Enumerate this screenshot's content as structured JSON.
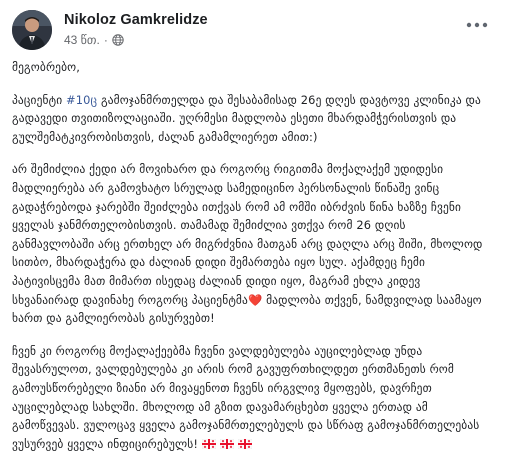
{
  "post": {
    "author": "Nikoloz Gamkrelidze",
    "time": "43 წთ.",
    "separator": "·",
    "privacy_icon": "globe-icon",
    "more_icon": "ellipsis-icon"
  },
  "paragraphs": {
    "p0": "მეგობრებო,",
    "p1_before": "პაციენტი ",
    "p1_hashtag": "#10ც",
    "p1_after": " გამოჯანმრთელდა და შესაბამისად 26ე დღეს დავტოვე კლინიკა და გადავედი თვითიზოლაციაში. უღრმესი მადლობა ესეთი მხარდამჭერისთვის და გულშემატკივრობისთვის, ძალან გამამლიერეთ ამით:)",
    "p2_before": "არ შემიძლია ქედი არ მოვიხარო და როგორც რიგითმა მოქალაქემ უდიდესი მადლიერება არ გამოვხატო სრულად სამედიცინო პერსონალის წინაშე ვინც გადაჭრებოდა ჯარებში შეიძლება ითქვას რომ ამ ომში იბრძვის წინა ხაზზე ჩვენი ყველას ჯანმრთელობისთვის. თამამად შემიძლია ვთქვა რომ 26 დღის განმავლობაში არც ერთხელ არ მიგრძვნია მათგან არც დაღლა არც შიში, მხოლოდ სითბო, მხარდაჭერა და ძალიან დიდი შემართება იყო სულ. აქამდეც ჩემი პატივისცემა მათ მიმართ ისედაც ძალიან დიდი იყო, მაგრამ ეხლა კიდევ სხვანაირად დავინახე როგორც პაციენტმა",
    "p2_heart": "❤️",
    "p2_after": " მადლობა თქვენ, ნამდვილად საამაყო ხართ და გამლიერობას გისურვებთ!",
    "p3_before": "ჩვენ კი როგორც მოქალაქეებმა ჩვენი ვალდებულება აუცილებლად უნდა შევასრულოთ, ვალდებულება კი არის რომ გავუფრთხილდეთ ერთმანეთს რომ გამოუსწორებელი ზიანი არ მივაყენოთ ჩვენს ირგვლივ მყოფებს, დავრჩეთ აუცილებლად სახლში. მხოლოდ ამ გზით დავამარცხებთ ყველა ერთად ამ გამოწვევას. ვულოცავ ყველა გამოჯანმრთელებულს და სწრაფ გამოჯანმრთელებას ვუსურვებ ყველა ინფიცირებულს!"
  },
  "colors": {
    "hashtag": "#385898",
    "text": "#1c1e21",
    "meta": "#65676b",
    "heart": "#e0245e",
    "flag_red": "#e8112d"
  },
  "flags": [
    "georgia-flag-icon",
    "georgia-flag-icon",
    "georgia-flag-icon"
  ]
}
